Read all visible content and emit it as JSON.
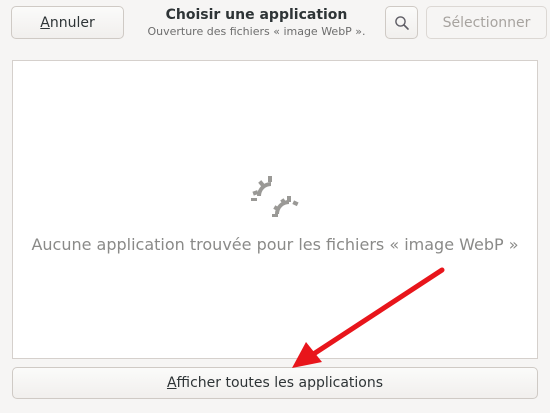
{
  "header": {
    "cancel_prefix": "",
    "cancel_mnemonic": "A",
    "cancel_rest": "nnuler",
    "title": "Choisir une application",
    "subtitle": "Ouverture des fichiers « image WebP ».",
    "select_label": "Sélectionner",
    "search_icon": "search-icon"
  },
  "main": {
    "empty_message": "Aucune application trouvée pour les fichiers « image WebP »",
    "empty_icon": "application-missing-icon"
  },
  "footer": {
    "show_all_mnemonic": "A",
    "show_all_rest": "fficher toutes les applications"
  },
  "annotation": {
    "arrow_color": "#e8151b"
  },
  "colors": {
    "window_bg": "#f6f5f4",
    "content_bg": "#ffffff",
    "border": "#d5d0cc",
    "muted_text": "#8a8a88"
  }
}
